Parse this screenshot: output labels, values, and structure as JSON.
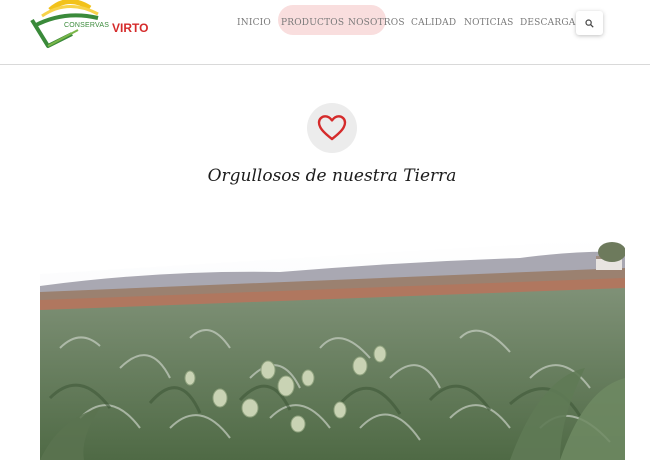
{
  "logo": {
    "prefix": "CONSERVAS",
    "brand": "VIRTO",
    "icon": "sun-leaf-logo"
  },
  "nav": {
    "items": [
      {
        "label": "INICIO"
      },
      {
        "label": "PRODUCTOS"
      },
      {
        "label": "NOSOTROS"
      },
      {
        "label": "CALIDAD"
      },
      {
        "label": "NOTICIAS"
      },
      {
        "label": "DESCARGAS"
      }
    ],
    "search_icon": "search-icon"
  },
  "hero": {
    "icon": "heart-icon",
    "tagline": "Orgullosos de nuestra Tierra"
  },
  "photo": {
    "subject": "artichoke field"
  },
  "colors": {
    "accent": "#d52b2b",
    "pill": "#f9dede",
    "logo_green": "#3a8a3a",
    "logo_yellow": "#f2c21b"
  }
}
